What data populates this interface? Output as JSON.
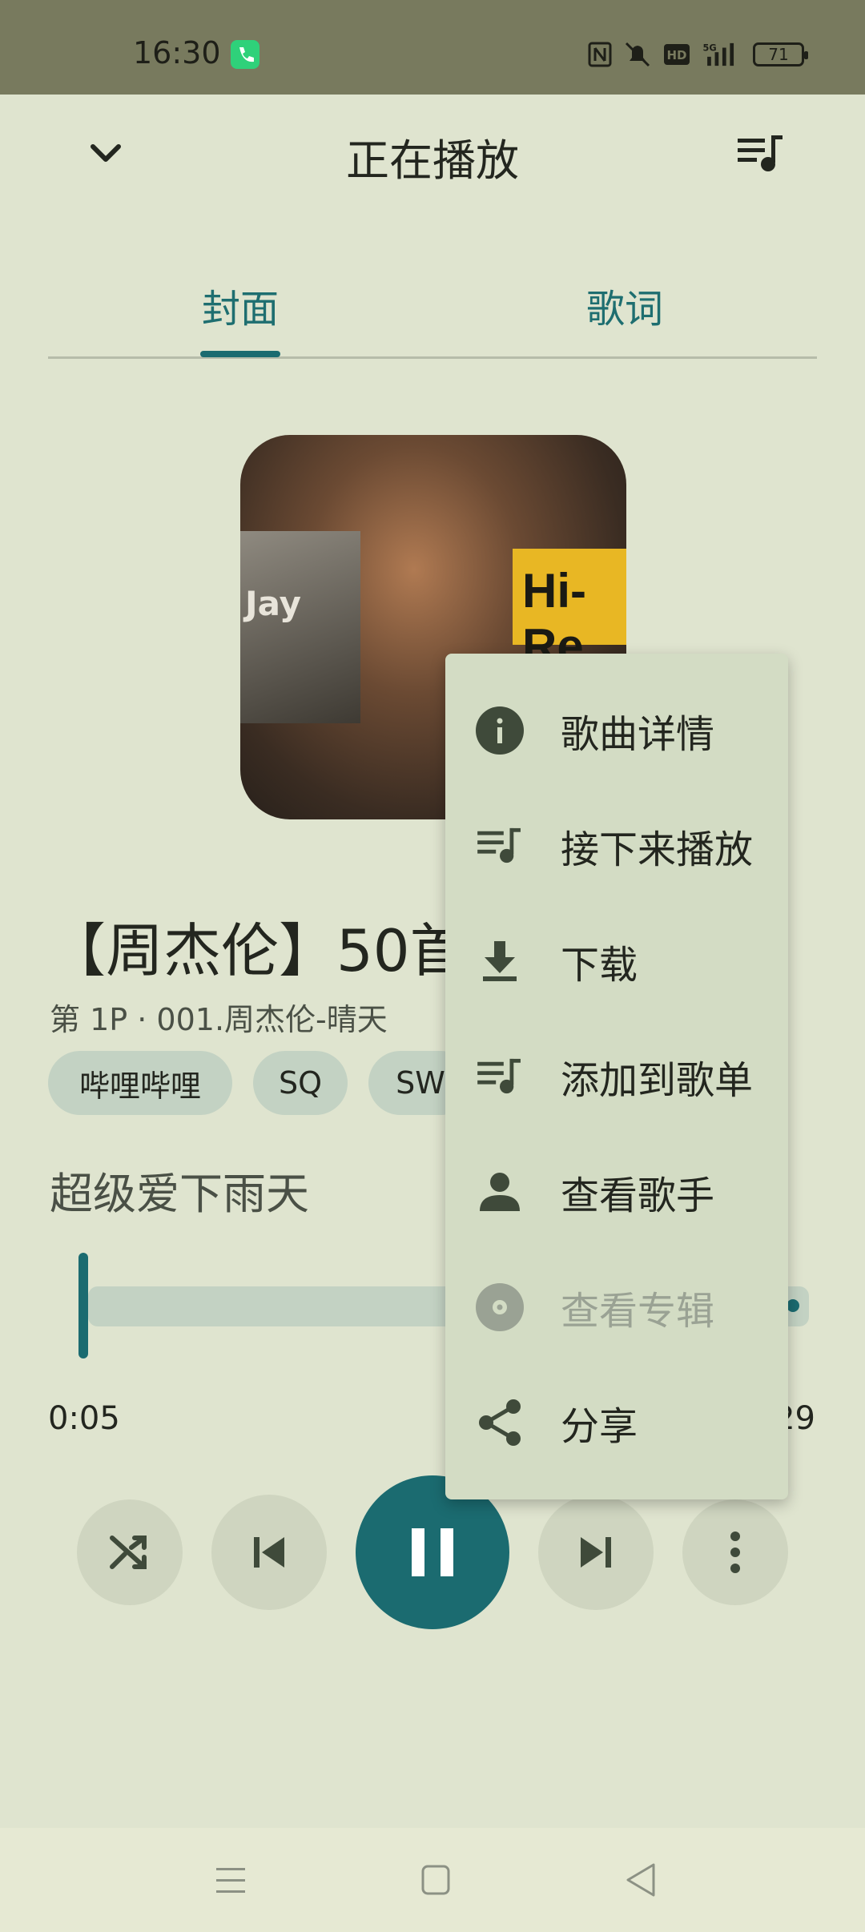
{
  "status_bar": {
    "time": "16:30",
    "battery": "71",
    "icons": [
      "call-icon",
      "nfc-icon",
      "mute-icon",
      "hd-icon",
      "5g-signal-icon",
      "battery-icon"
    ]
  },
  "header": {
    "title": "正在播放",
    "icons": [
      "chevron-down-icon",
      "queue-music-icon"
    ]
  },
  "tabs": [
    {
      "label": "封面",
      "selected": true
    },
    {
      "label": "歌词",
      "selected": false
    }
  ],
  "album_art": {
    "inset_text": "Jay",
    "badge_text": "Hi-Re"
  },
  "song": {
    "title": "【周杰伦】50首",
    "subtitle": "第 1P · 001.周杰伦-晴天",
    "tags": [
      "哔哩哔哩",
      "SQ",
      "SW"
    ],
    "artist": "超级爱下雨天"
  },
  "progress": {
    "current": "0:05",
    "total": "29",
    "fraction": 0.02
  },
  "controls": [
    "shuffle-icon",
    "skip-previous-icon",
    "pause-icon",
    "skip-next-icon",
    "more-vert-icon"
  ],
  "menu": {
    "items": [
      {
        "label": "歌曲详情",
        "icon": "info-icon",
        "enabled": true
      },
      {
        "label": "接下来播放",
        "icon": "queue-music-icon",
        "enabled": true
      },
      {
        "label": "下载",
        "icon": "download-icon",
        "enabled": true
      },
      {
        "label": "添加到歌单",
        "icon": "playlist-add-icon",
        "enabled": true
      },
      {
        "label": "查看歌手",
        "icon": "person-icon",
        "enabled": true
      },
      {
        "label": "查看专辑",
        "icon": "album-icon",
        "enabled": false
      },
      {
        "label": "分享",
        "icon": "share-icon",
        "enabled": true
      }
    ]
  },
  "colors": {
    "accent": "#1b6b70",
    "background": "#dfe4cf",
    "menu_background": "#d3dcc4"
  }
}
